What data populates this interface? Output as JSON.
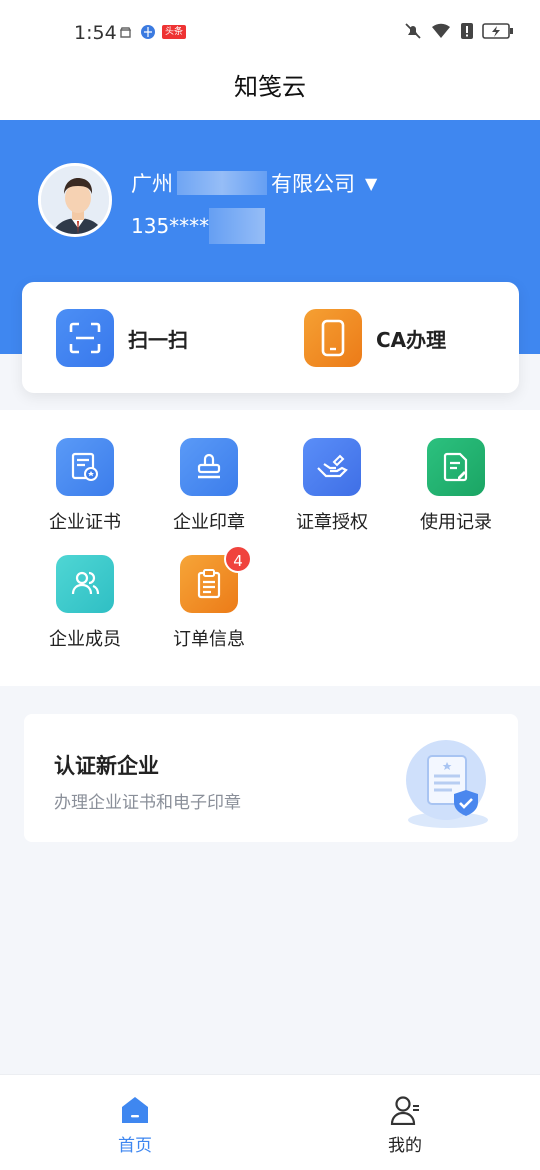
{
  "status_bar": {
    "time": "1:54",
    "news_badge": "头条",
    "icons": [
      "cloud-icon",
      "browser-icon",
      "news-icon",
      "mute-bell-icon",
      "wifi-icon",
      "alert-icon",
      "battery-charging-icon"
    ]
  },
  "nav": {
    "title": "知笺云"
  },
  "account": {
    "company_prefix": "广州",
    "company_suffix": "有限公司",
    "dropdown_icon": "▼",
    "phone": "135****"
  },
  "quick_actions": [
    {
      "label": "扫一扫",
      "icon": "scan-icon",
      "color": "#3f87f0"
    },
    {
      "label": "CA办理",
      "icon": "phone-icon",
      "color": "#ef8622"
    }
  ],
  "grid": [
    {
      "label": "企业证书",
      "icon": "certificate-icon"
    },
    {
      "label": "企业印章",
      "icon": "stamp-icon"
    },
    {
      "label": "证章授权",
      "icon": "authorize-hand-icon"
    },
    {
      "label": "使用记录",
      "icon": "record-document-icon"
    },
    {
      "label": "企业成员",
      "icon": "members-icon"
    },
    {
      "label": "订单信息",
      "icon": "clipboard-icon",
      "badge": "4"
    }
  ],
  "certify": {
    "title": "认证新企业",
    "subtitle": "办理企业证书和电子印章"
  },
  "tabbar": [
    {
      "label": "首页",
      "icon": "home-icon",
      "active": true
    },
    {
      "label": "我的",
      "icon": "user-icon",
      "active": false
    }
  ],
  "colors": {
    "primary": "#3f87f0",
    "badge": "#f0433d",
    "page_bg": "#f4f6fa"
  }
}
